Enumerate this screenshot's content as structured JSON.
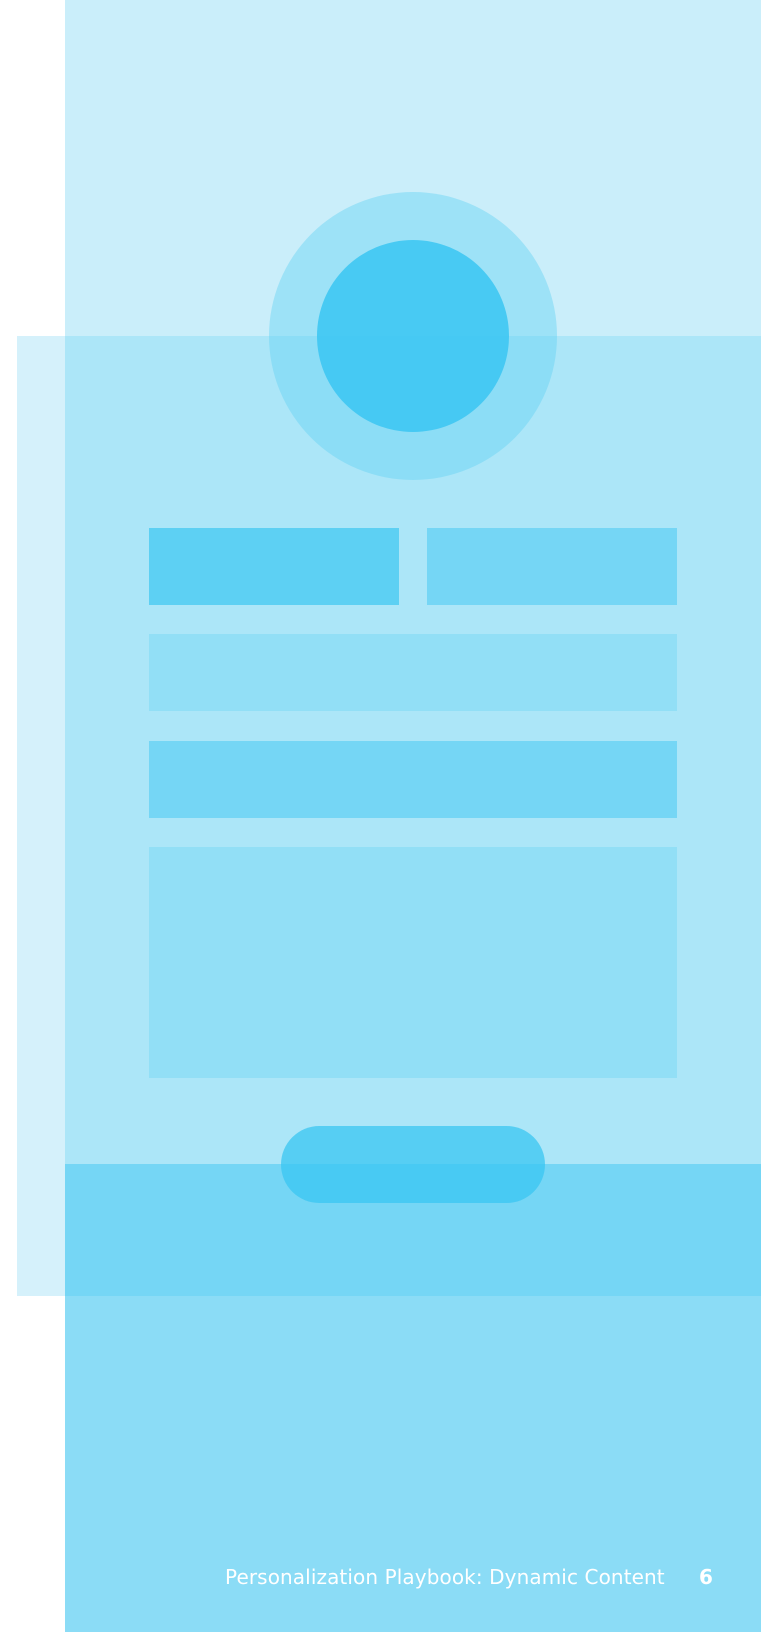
{
  "footer": {
    "title": "Personalization Playbook: Dynamic Content",
    "page_number": "6"
  },
  "colors": {
    "top_band": "#caeefa",
    "panel": "#ace6f8",
    "panel_edge": "#d5f1fb",
    "accent": "#39c5f2",
    "bottom_band": "#8bdcf6",
    "text": "#ffffff"
  }
}
